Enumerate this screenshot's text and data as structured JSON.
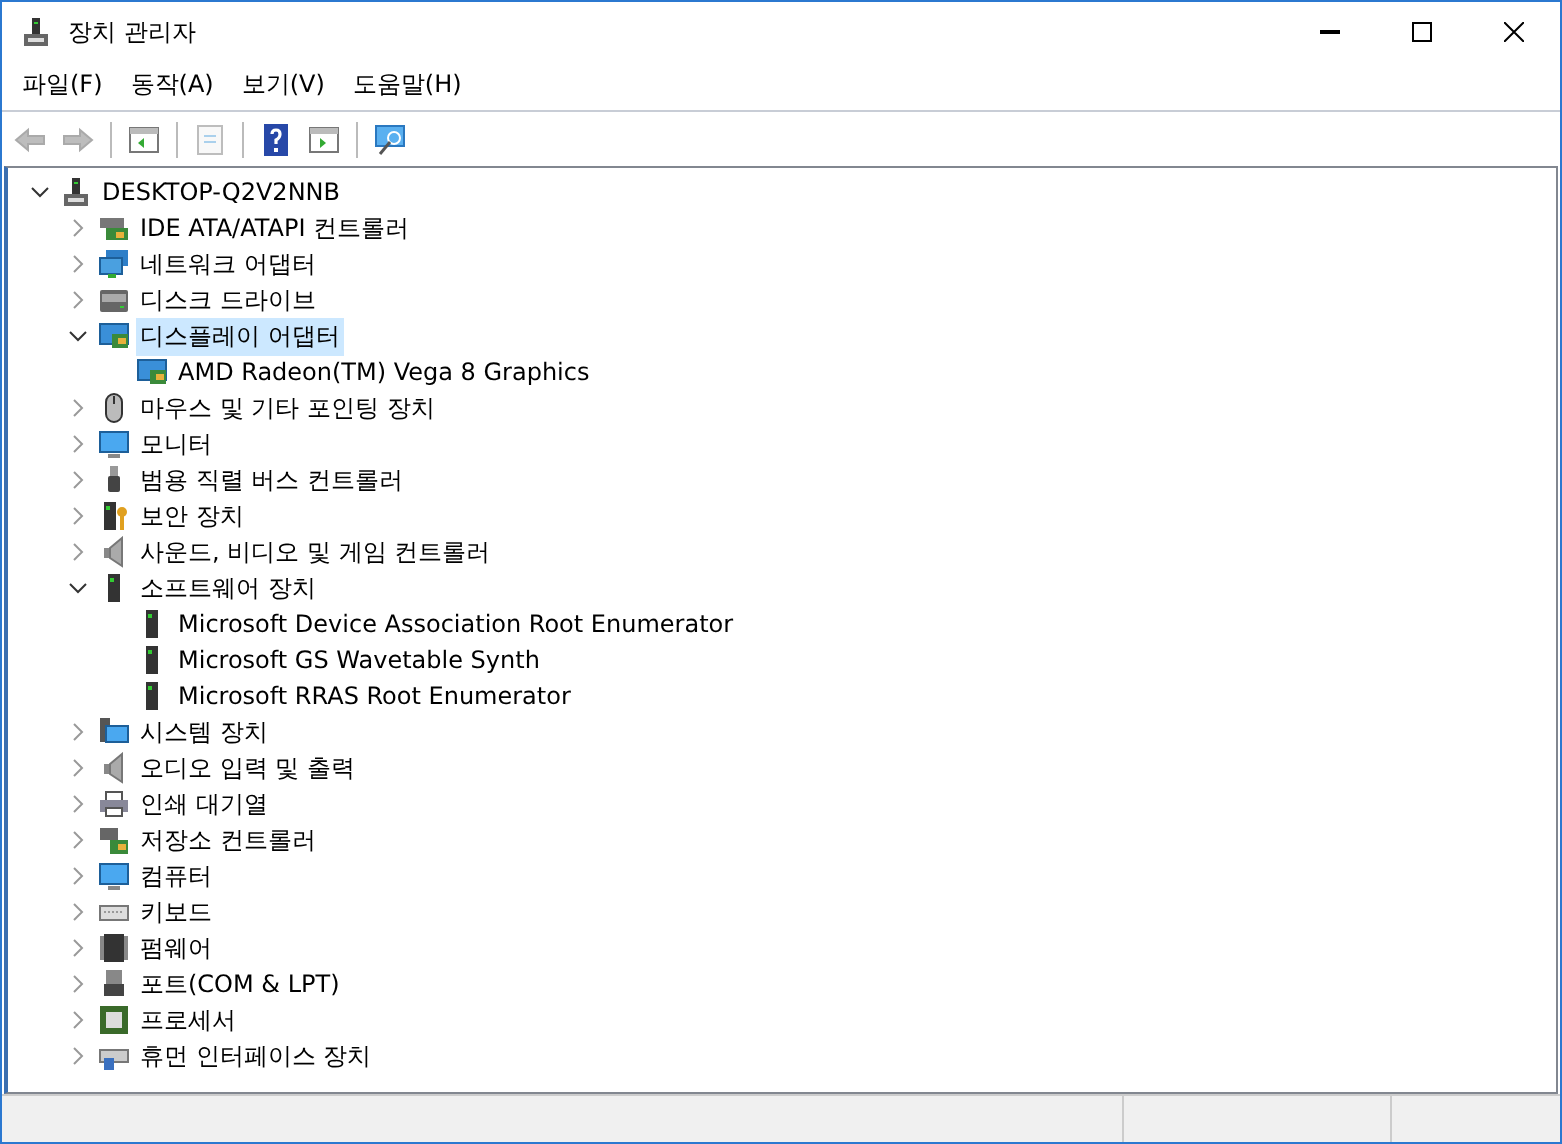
{
  "window": {
    "title": "장치 관리자"
  },
  "menu": [
    "파일(F)",
    "동작(A)",
    "보기(V)",
    "도움말(H)"
  ],
  "toolbar": [
    {
      "kind": "back",
      "disabled": true
    },
    {
      "kind": "forward",
      "disabled": true
    },
    {
      "kind": "sep"
    },
    {
      "kind": "tree-toggle",
      "disabled": false
    },
    {
      "kind": "sep"
    },
    {
      "kind": "properties",
      "disabled": true
    },
    {
      "kind": "sep"
    },
    {
      "kind": "help",
      "disabled": false
    },
    {
      "kind": "run",
      "disabled": false
    },
    {
      "kind": "sep"
    },
    {
      "kind": "scan",
      "disabled": false
    }
  ],
  "tree": [
    {
      "label": "DESKTOP-Q2V2NNB",
      "kind": "computer-root",
      "expanded": true,
      "selected": false,
      "children": [
        {
          "label": "IDE ATA/ATAPI 컨트롤러",
          "kind": "controller",
          "expanded": false,
          "selected": false
        },
        {
          "label": "네트워크 어댑터",
          "kind": "network",
          "expanded": false,
          "selected": false
        },
        {
          "label": "디스크 드라이브",
          "kind": "disk",
          "expanded": false,
          "selected": false
        },
        {
          "label": "디스플레이 어댑터",
          "kind": "display",
          "expanded": true,
          "selected": true,
          "children": [
            {
              "label": "AMD Radeon(TM) Vega 8 Graphics",
              "kind": "display",
              "selected": false
            }
          ]
        },
        {
          "label": "마우스 및 기타 포인팅 장치",
          "kind": "mouse",
          "expanded": false,
          "selected": false
        },
        {
          "label": "모니터",
          "kind": "monitor",
          "expanded": false,
          "selected": false
        },
        {
          "label": "범용 직렬 버스 컨트롤러",
          "kind": "usb",
          "expanded": false,
          "selected": false
        },
        {
          "label": "보안 장치",
          "kind": "security",
          "expanded": false,
          "selected": false
        },
        {
          "label": "사운드, 비디오 및 게임 컨트롤러",
          "kind": "sound",
          "expanded": false,
          "selected": false
        },
        {
          "label": "소프트웨어 장치",
          "kind": "device",
          "expanded": true,
          "selected": false,
          "children": [
            {
              "label": "Microsoft Device Association Root Enumerator",
              "kind": "device",
              "selected": false
            },
            {
              "label": "Microsoft GS Wavetable Synth",
              "kind": "device",
              "selected": false
            },
            {
              "label": "Microsoft RRAS Root Enumerator",
              "kind": "device",
              "selected": false
            }
          ]
        },
        {
          "label": "시스템 장치",
          "kind": "system",
          "expanded": false,
          "selected": false
        },
        {
          "label": "오디오 입력 및 출력",
          "kind": "sound",
          "expanded": false,
          "selected": false
        },
        {
          "label": "인쇄 대기열",
          "kind": "printer",
          "expanded": false,
          "selected": false
        },
        {
          "label": "저장소 컨트롤러",
          "kind": "storage",
          "expanded": false,
          "selected": false
        },
        {
          "label": "컴퓨터",
          "kind": "monitor",
          "expanded": false,
          "selected": false
        },
        {
          "label": "키보드",
          "kind": "keyboard",
          "expanded": false,
          "selected": false
        },
        {
          "label": "펌웨어",
          "kind": "chip",
          "expanded": false,
          "selected": false
        },
        {
          "label": "포트(COM & LPT)",
          "kind": "port",
          "expanded": false,
          "selected": false
        },
        {
          "label": "프로세서",
          "kind": "processor",
          "expanded": false,
          "selected": false
        },
        {
          "label": "휴먼 인터페이스 장치",
          "kind": "hid",
          "expanded": false,
          "selected": false
        }
      ]
    }
  ]
}
